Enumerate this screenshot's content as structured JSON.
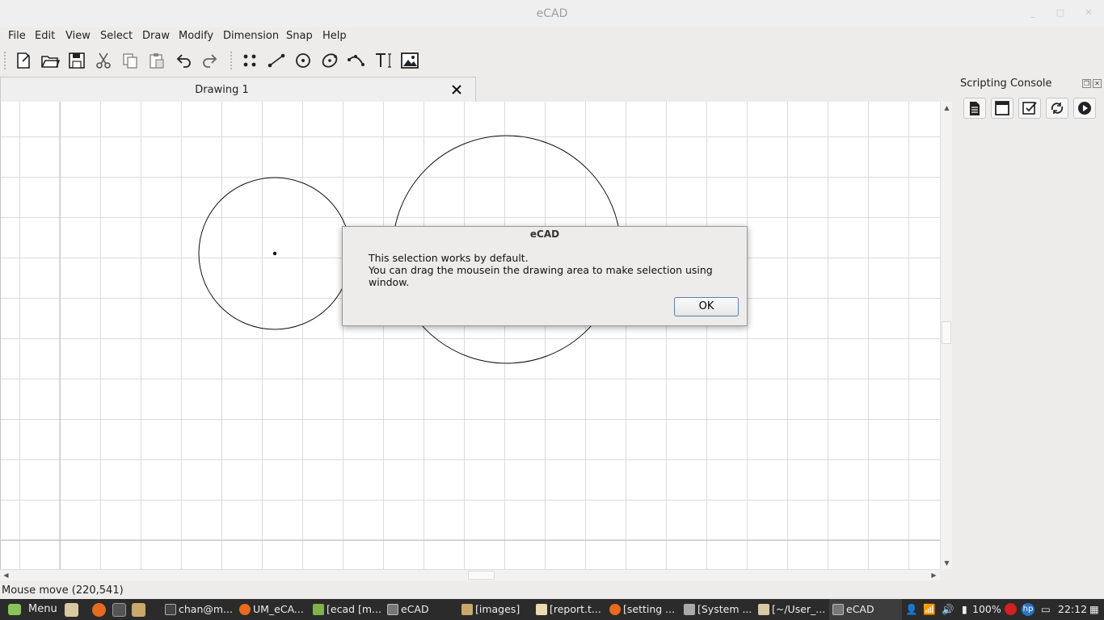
{
  "window": {
    "title": "eCAD"
  },
  "menu": [
    "File",
    "Edit",
    "View",
    "Select",
    "Draw",
    "Modify",
    "Dimension",
    "Snap",
    "Help"
  ],
  "toolbar": {
    "buttons": [
      "new-icon",
      "open-icon",
      "save-icon",
      "cut-icon",
      "copy-icon",
      "paste-icon",
      "undo-icon",
      "redo-icon",
      "point-icon",
      "line-icon",
      "circle-icon",
      "ellipse-icon",
      "arc-icon",
      "text-icon",
      "image-icon"
    ]
  },
  "tab": {
    "label": "Drawing 1"
  },
  "console": {
    "title": "Scripting Console"
  },
  "dialog": {
    "title": "eCAD",
    "line1": "This selection works by default.",
    "line2": "You can drag the mousein the drawing area to make selection using window.",
    "ok_label": "OK"
  },
  "status": {
    "text": "Mouse move (220,541)"
  },
  "taskbar": {
    "menu_label": "Menu",
    "tasks": [
      {
        "label": "chan@m..."
      },
      {
        "label": "UM_eCA..."
      },
      {
        "label": "[ecad [m..."
      },
      {
        "label": "eCAD"
      },
      {
        "label": "[images]"
      },
      {
        "label": "[report.t..."
      },
      {
        "label": "[setting ..."
      },
      {
        "label": "[System ..."
      },
      {
        "label": "[~/User_..."
      },
      {
        "label": "eCAD"
      }
    ],
    "battery": "100%",
    "clock": "22:12"
  },
  "colors": {
    "crosshair": "#cc2222",
    "accent": "#5b7fb5"
  }
}
